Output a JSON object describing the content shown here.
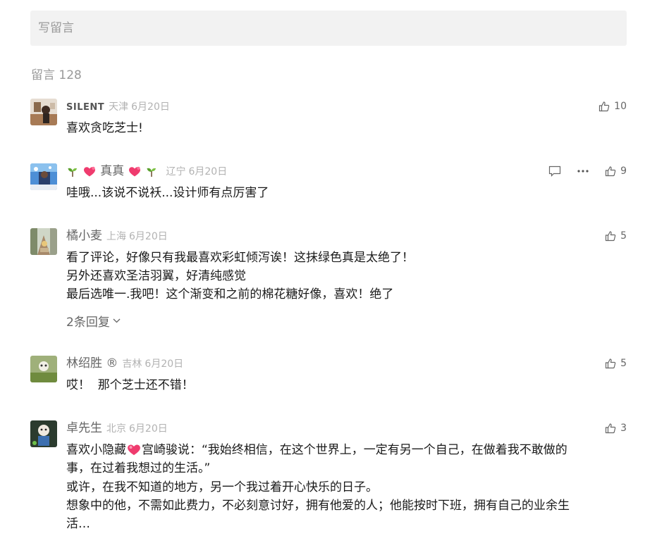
{
  "write_box": {
    "placeholder": "写留言"
  },
  "comment_count_label": "留言 128",
  "comments": [
    {
      "nickname": "SILENT",
      "location": "天津",
      "date": "6月20日",
      "likes": "10",
      "lines": [
        "喜欢贪吃芝士!"
      ]
    },
    {
      "nickname": "真真",
      "nickname_emoji": [
        "seedling",
        "heart",
        "heart",
        "seedling"
      ],
      "location": "辽宁",
      "date": "6月20日",
      "likes": "9",
      "lines": [
        "哇哦...该说不说袄...设计师有点厉害了"
      ],
      "action_icons": [
        "reply-icon",
        "more-icon"
      ]
    },
    {
      "nickname": "橘小麦",
      "location": "上海",
      "date": "6月20日",
      "likes": "5",
      "lines": [
        "看了评论，好像只有我最喜欢彩虹倾泻诶！这抹绿色真是太绝了！",
        "另外还喜欢圣洁羽翼，好清纯感觉",
        "最后选唯一.我吧！这个渐变和之前的棉花糖好像，喜欢！绝了"
      ],
      "replies_label": "2条回复"
    },
    {
      "nickname": "林绍胜 ®",
      "location": "吉林",
      "date": "6月20日",
      "likes": "5",
      "lines": [
        "哎！  那个芝士还不错！"
      ]
    },
    {
      "nickname": "卓先生",
      "location": "北京",
      "date": "6月20日",
      "likes": "3",
      "lines": [
        "宫崎骏说：“我始终相信，在这个世界上，一定有另一个自己，在做着我不敢做的",
        "事，在过着我想过的生活。”",
        "或许，在我不知道的地方，另一个我过着开心快乐的日子。",
        "想象中的他，不需如此费力，不必刻意讨好，拥有他爱的人；他能按时下班，拥有自己的业余生",
        "活…"
      ],
      "line1_prefix": "喜欢小隐藏",
      "prefix_emoji": "heart"
    }
  ],
  "colors": {
    "background": "#ffffff",
    "input_bg": "#f2f2f2",
    "muted": "#b2b2b2",
    "text": "#1a1a1a",
    "heart": "#ef3b6e",
    "seedling": "#5aa02c"
  }
}
